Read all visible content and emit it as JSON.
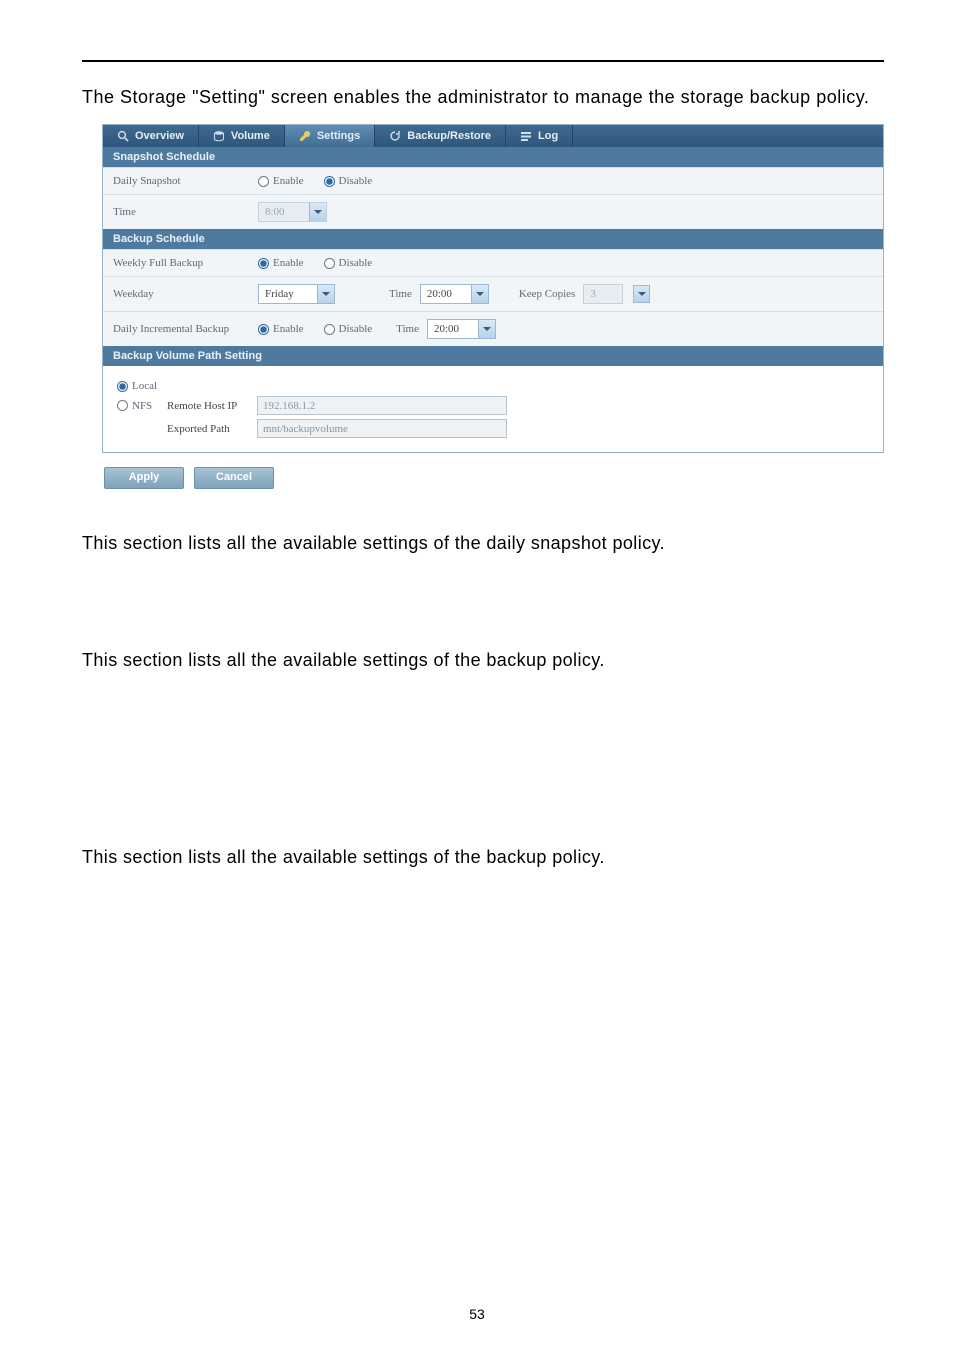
{
  "intro": "The Storage \"Setting\" screen enables the administrator to manage the storage backup policy.",
  "tabs": {
    "overview": "Overview",
    "volume": "Volume",
    "settings": "Settings",
    "backup_restore": "Backup/Restore",
    "log": "Log"
  },
  "sections": {
    "snapshot_schedule": "Snapshot Schedule",
    "backup_schedule": "Backup Schedule",
    "backup_volume_path_setting": "Backup Volume Path Setting"
  },
  "radio": {
    "enable": "Enable",
    "disable": "Disable"
  },
  "snapshot": {
    "daily_snapshot_label": "Daily Snapshot",
    "time_label": "Time",
    "time_value": "8:00"
  },
  "backup": {
    "weekly_full_label": "Weekly Full Backup",
    "weekday_label": "Weekday",
    "weekday_value": "Friday",
    "time_label": "Time",
    "time_value": "20:00",
    "keep_copies_label": "Keep Copies",
    "keep_copies_value": "3",
    "daily_incremental_label": "Daily Incremental Backup",
    "di_time_value": "20:00"
  },
  "path": {
    "local_label": "Local",
    "nfs_label": "NFS",
    "remote_host_ip_label": "Remote Host IP",
    "remote_host_ip_value": "192.168.1.2",
    "exported_path_label": "Exported Path",
    "exported_path_value": "mnt/backupvolume"
  },
  "buttons": {
    "apply": "Apply",
    "cancel": "Cancel"
  },
  "paragraphs": {
    "p1": "This section lists all the available settings of the daily snapshot policy.",
    "p2": "This section lists all the available settings of the backup policy.",
    "p3": "This section lists all the available settings of the backup policy."
  },
  "page_number": "53"
}
